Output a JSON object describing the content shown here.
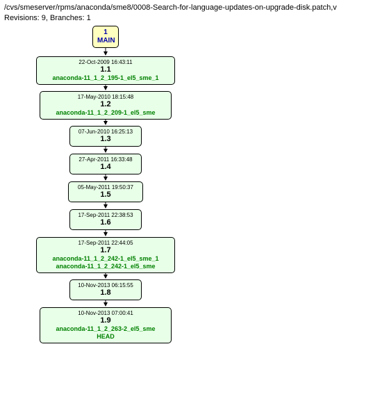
{
  "header": {
    "path": "/cvs/smeserver/rpms/anaconda/sme8/0008-Search-for-language-updates-on-upgrade-disk.patch,v",
    "meta": "Revisions: 9, Branches: 1"
  },
  "main": {
    "index": "1",
    "label": "MAIN"
  },
  "revisions": [
    {
      "date": "22-Oct-2009 16:43:11",
      "ver": "1.1",
      "tags": [
        "anaconda-11_1_2_195-1_el5_sme_1"
      ]
    },
    {
      "date": "17-May-2010 18:15:48",
      "ver": "1.2",
      "tags": [
        "anaconda-11_1_2_209-1_el5_sme"
      ]
    },
    {
      "date": "07-Jun-2010 16:25:13",
      "ver": "1.3",
      "tags": []
    },
    {
      "date": "27-Apr-2011 16:33:48",
      "ver": "1.4",
      "tags": []
    },
    {
      "date": "05-May-2011 19:50:37",
      "ver": "1.5",
      "tags": []
    },
    {
      "date": "17-Sep-2011 22:38:53",
      "ver": "1.6",
      "tags": []
    },
    {
      "date": "17-Sep-2011 22:44:05",
      "ver": "1.7",
      "tags": [
        "anaconda-11_1_2_242-1_el5_sme_1",
        "anaconda-11_1_2_242-1_el5_sme"
      ]
    },
    {
      "date": "10-Nov-2013 06:15:55",
      "ver": "1.8",
      "tags": []
    },
    {
      "date": "10-Nov-2013 07:00:41",
      "ver": "1.9",
      "tags": [
        "anaconda-11_1_2_263-2_el5_sme",
        "HEAD"
      ]
    }
  ]
}
